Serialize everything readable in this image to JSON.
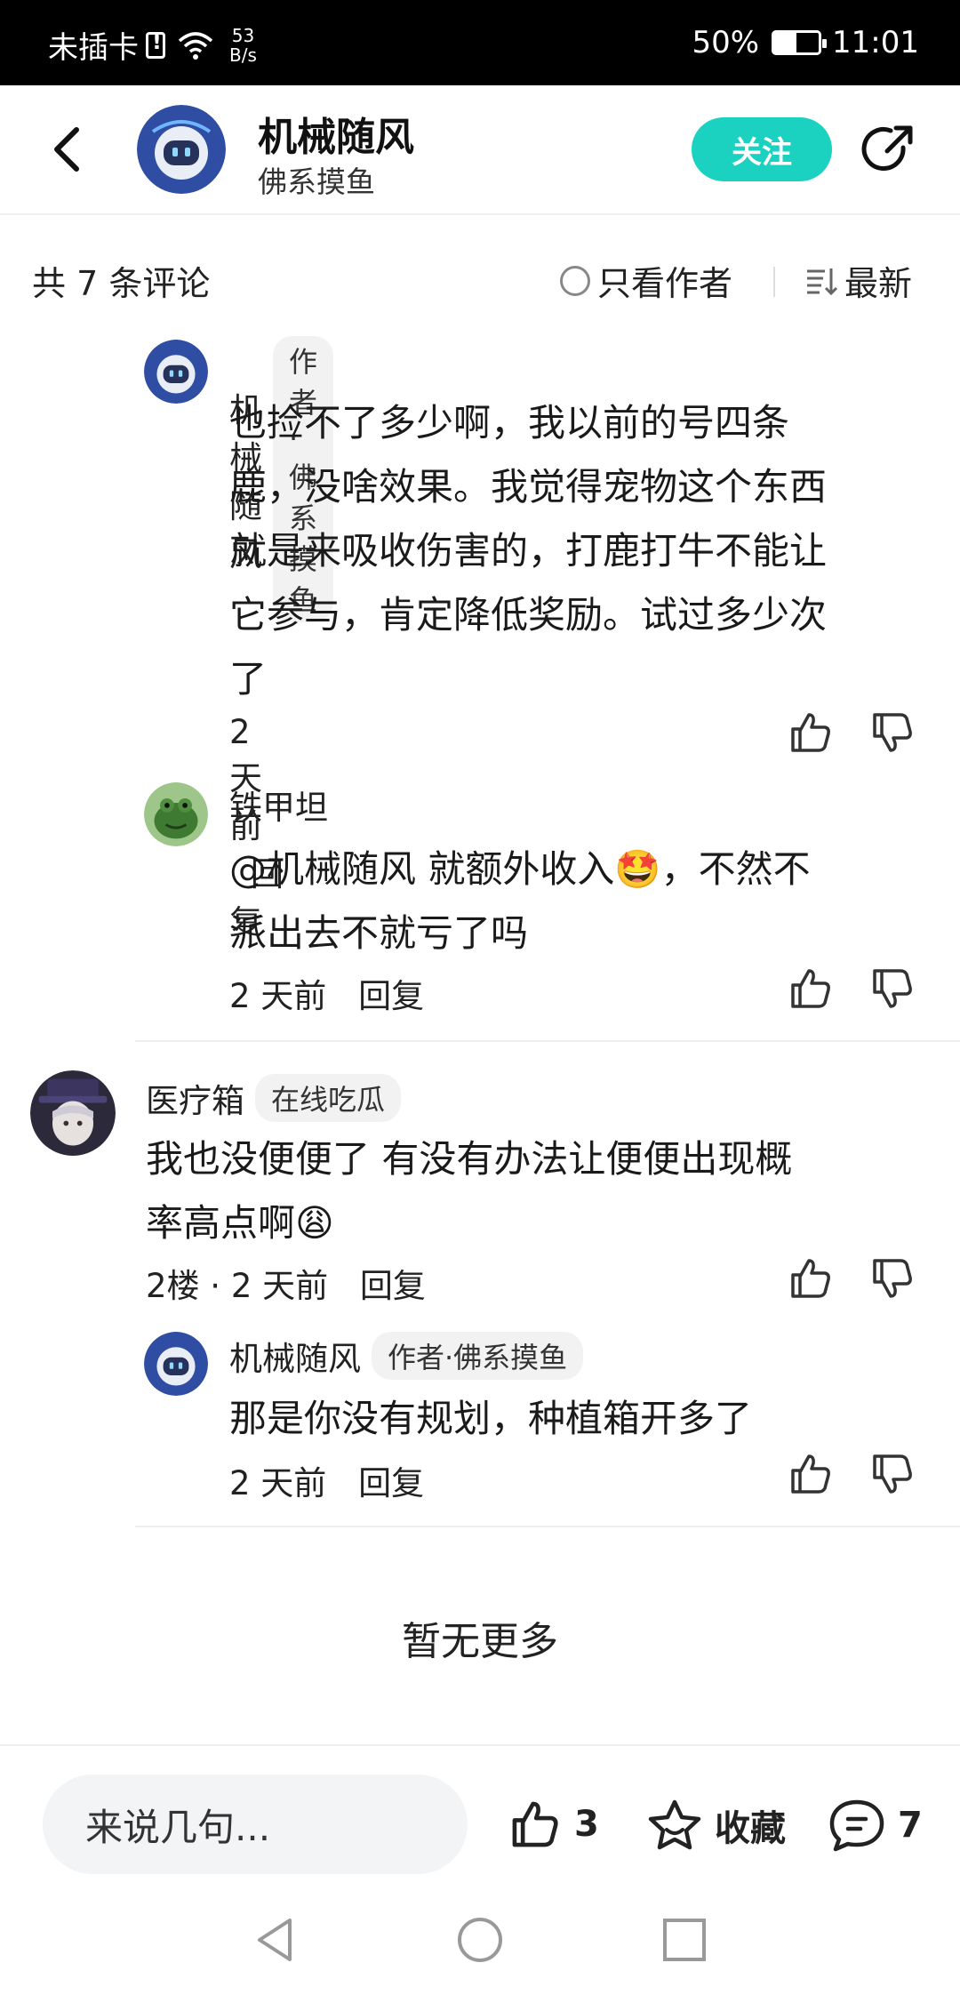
{
  "status_bar": {
    "carrier": "未插卡",
    "net_speed_value": "53",
    "net_speed_unit": "B/s",
    "battery": "50%",
    "time": "11:01"
  },
  "header": {
    "name": "机械随风",
    "subtitle": "佛系摸鱼",
    "follow_label": "关注"
  },
  "comments_bar": {
    "count_text": "共 7 条评论",
    "author_only_label": "只看作者",
    "sort_label": "最新"
  },
  "comments": [
    {
      "name": "机械随风",
      "tag": "作者·佛系摸鱼",
      "text_lines": [
        "也捡不了多少啊，我以前的号四条",
        "鹿，没啥效果。我觉得宠物这个东西",
        "就是来吸收伤害的，打鹿打牛不能让",
        "它参与，肯定降低奖励。试过多少次",
        "了"
      ],
      "time": "2 天前",
      "reply": "回复"
    },
    {
      "name": "铁甲坦",
      "text_lines": [
        "@机械随风  就额外收入🤩，不然不",
        "派出去不就亏了吗"
      ],
      "time": "2 天前",
      "reply": "回复"
    },
    {
      "name": "医疗箱",
      "tag": "在线吃瓜",
      "text_lines": [
        "我也没便便了 有没有办法让便便出现概",
        "率高点啊😩"
      ],
      "floor": "2楼 · 2 天前",
      "reply": "回复"
    },
    {
      "name": "机械随风",
      "tag": "作者·佛系摸鱼",
      "text_lines": [
        "那是你没有规划，种植箱开多了"
      ],
      "time": "2 天前",
      "reply": "回复"
    }
  ],
  "no_more": "暂无更多",
  "bottom_bar": {
    "input_placeholder": "来说几句...",
    "like_count": "3",
    "favorite_label": "收藏",
    "comment_count": "7"
  },
  "colors": {
    "accent": "#1bd1bf",
    "tag_bg": "#f2f2f2"
  }
}
